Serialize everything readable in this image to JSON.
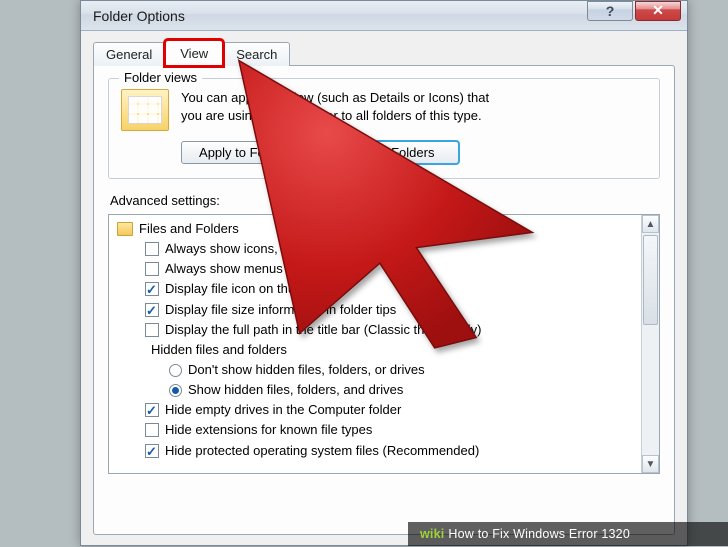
{
  "window": {
    "title": "Folder Options"
  },
  "tabs": {
    "general": "General",
    "view": "View",
    "search": "Search"
  },
  "folder_views": {
    "legend": "Folder views",
    "description_line1": "You can apply the view (such as Details or Icons) that",
    "description_line2": "you are using for this folder to all folders of this type.",
    "apply_btn": "Apply to Folders",
    "reset_btn": "Reset Folders"
  },
  "advanced": {
    "label": "Advanced settings:",
    "root": "Files and Folders",
    "items": [
      {
        "label": "Always show icons, never thumbnails",
        "checked": false
      },
      {
        "label": "Always show menus",
        "checked": false
      },
      {
        "label": "Display file icon on thumbnails",
        "checked": true
      },
      {
        "label": "Display file size information in folder tips",
        "checked": true
      },
      {
        "label": "Display the full path in the title bar (Classic theme only)",
        "checked": false
      }
    ],
    "hidden_group": {
      "label": "Hidden files and folders",
      "options": [
        {
          "label": "Don't show hidden files, folders, or drives",
          "selected": false
        },
        {
          "label": "Show hidden files, folders, and drives",
          "selected": true
        }
      ]
    },
    "items2": [
      {
        "label": "Hide empty drives in the Computer folder",
        "checked": true
      },
      {
        "label": "Hide extensions for known file types",
        "checked": false
      },
      {
        "label": "Hide protected operating system files (Recommended)",
        "checked": true
      }
    ]
  },
  "watermark": {
    "brand": "wiki",
    "text": "How to Fix Windows Error 1320"
  }
}
